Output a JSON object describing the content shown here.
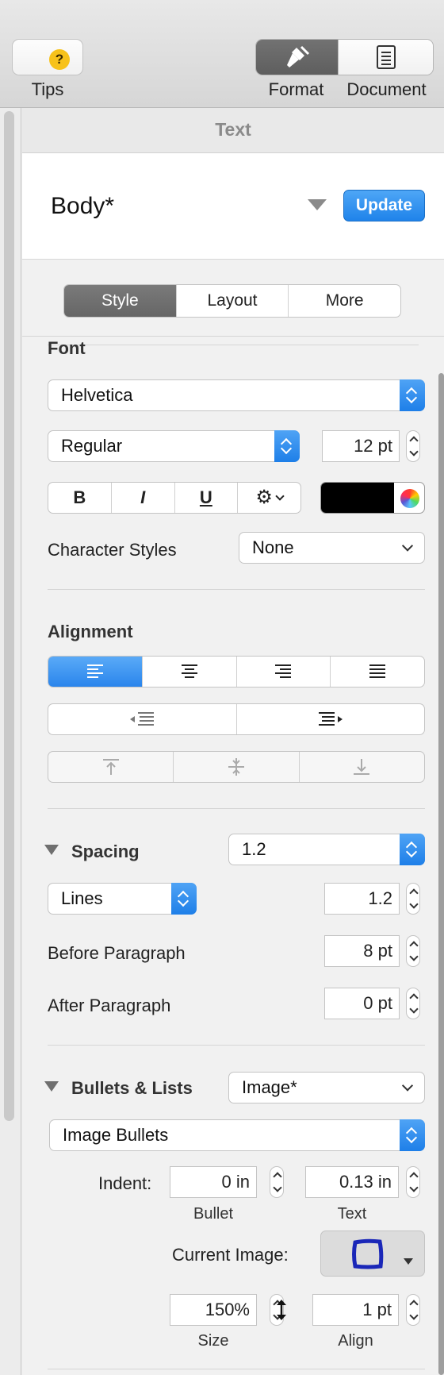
{
  "toolbar": {
    "tips_label": "Tips",
    "tips_icon": "?",
    "format_label": "Format",
    "document_label": "Document"
  },
  "panel": {
    "title": "Text",
    "style_name": "Body*",
    "update_label": "Update",
    "tabs": [
      {
        "label": "Style",
        "selected": true
      },
      {
        "label": "Layout",
        "selected": false
      },
      {
        "label": "More",
        "selected": false
      }
    ]
  },
  "font": {
    "section_label": "Font",
    "family": "Helvetica",
    "typeface": "Regular",
    "size": "12 pt",
    "bold_label": "B",
    "italic_label": "I",
    "underline_label": "U",
    "color": "#000000",
    "character_styles_label": "Character Styles",
    "character_style": "None"
  },
  "alignment": {
    "section_label": "Alignment",
    "selected": "left"
  },
  "spacing": {
    "section_label": "Spacing",
    "preset": "1.2",
    "mode": "Lines",
    "line_value": "1.2",
    "before_label": "Before Paragraph",
    "before_value": "8 pt",
    "after_label": "After Paragraph",
    "after_value": "0 pt"
  },
  "bullets": {
    "section_label": "Bullets & Lists",
    "preset": "Image*",
    "type": "Image Bullets",
    "indent_label": "Indent:",
    "bullet_indent": "0 in",
    "text_indent": "0.13 in",
    "bullet_sublabel": "Bullet",
    "text_sublabel": "Text",
    "current_image_label": "Current Image:",
    "size_value": "150%",
    "align_value": "1 pt",
    "size_sublabel": "Size",
    "align_sublabel": "Align"
  },
  "colors": {
    "accent": "#2a85ec",
    "bullet_image": "#1a27b8"
  }
}
